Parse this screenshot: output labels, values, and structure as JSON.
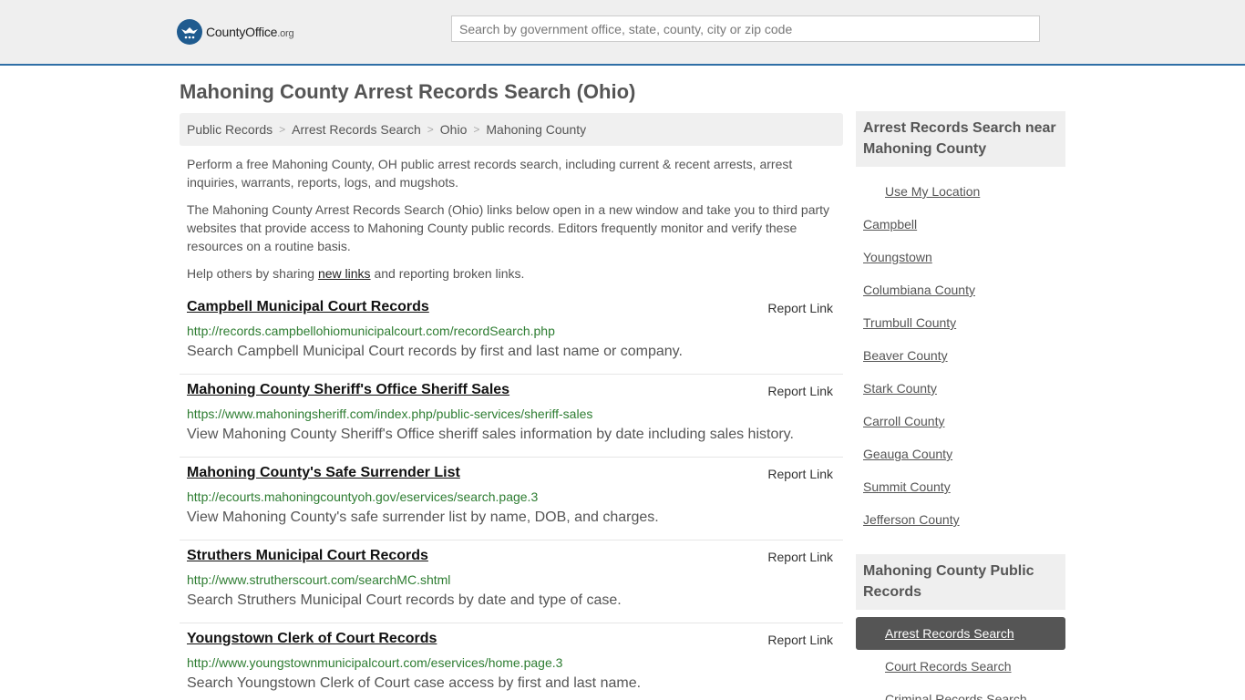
{
  "header": {
    "logo_brand": "CountyOffice",
    "logo_tld": ".org",
    "search_placeholder": "Search by government office, state, county, city or zip code"
  },
  "page_title": "Mahoning County Arrest Records Search (Ohio)",
  "breadcrumb": [
    "Public Records",
    "Arrest Records Search",
    "Ohio",
    "Mahoning County"
  ],
  "intro": {
    "p1": "Perform a free Mahoning County, OH public arrest records search, including current & recent arrests, arrest inquiries, warrants, reports, logs, and mugshots.",
    "p2": "The Mahoning County Arrest Records Search (Ohio) links below open in a new window and take you to third party websites that provide access to Mahoning County public records. Editors frequently monitor and verify these resources on a routine basis.",
    "p3_before": "Help others by sharing ",
    "p3_link": "new links",
    "p3_after": " and reporting broken links."
  },
  "entries": [
    {
      "title": "Campbell Municipal Court Records",
      "report": "Report Link",
      "url": "http://records.campbellohiomunicipalcourt.com/recordSearch.php",
      "desc": "Search Campbell Municipal Court records by first and last name or company."
    },
    {
      "title": "Mahoning County Sheriff's Office Sheriff Sales",
      "report": "Report Link",
      "url": "https://www.mahoningsheriff.com/index.php/public-services/sheriff-sales",
      "desc": "View Mahoning County Sheriff's Office sheriff sales information by date including sales history."
    },
    {
      "title": "Mahoning County's Safe Surrender List",
      "report": "Report Link",
      "url": "http://ecourts.mahoningcountyoh.gov/eservices/search.page.3",
      "desc": "View Mahoning County's safe surrender list by name, DOB, and charges."
    },
    {
      "title": "Struthers Municipal Court Records",
      "report": "Report Link",
      "url": "http://www.strutherscourt.com/searchMC.shtml",
      "desc": "Search Struthers Municipal Court records by date and type of case."
    },
    {
      "title": "Youngstown Clerk of Court Records",
      "report": "Report Link",
      "url": "http://www.youngstownmunicipalcourt.com/eservices/home.page.3",
      "desc": "Search Youngstown Clerk of Court case access by first and last name."
    }
  ],
  "sidebar": {
    "nearby_title_line1": "Arrest Records Search near",
    "nearby_title_line2": "Mahoning County",
    "use_location": "Use My Location",
    "nearby": [
      "Campbell",
      "Youngstown",
      "Columbiana County",
      "Trumbull County",
      "Beaver County",
      "Stark County",
      "Carroll County",
      "Geauga County",
      "Summit County",
      "Jefferson County"
    ],
    "records_title_line1": "Mahoning County Public",
    "records_title_line2": "Records",
    "records_active": "Arrest Records Search",
    "records": [
      "Court Records Search",
      "Criminal Records Search"
    ]
  },
  "colors": {
    "accent": "#2f6fa6",
    "url_green": "#2e7d32",
    "active_bg": "#555555"
  }
}
